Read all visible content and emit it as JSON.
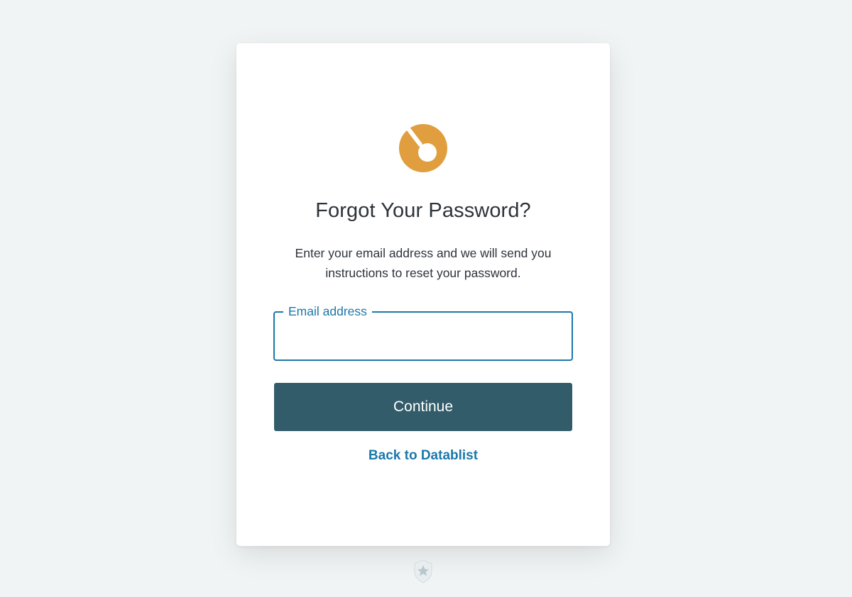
{
  "logo": {
    "icon": "datablist-logo-icon",
    "color": "#e09e3f"
  },
  "heading": "Forgot Your Password?",
  "description": "Enter your email address and we will send you instructions to reset your password.",
  "email_field": {
    "label": "Email address",
    "value": "",
    "border_color": "#1d77a8"
  },
  "continue_button": {
    "label": "Continue",
    "background": "#335c6a"
  },
  "back_link": {
    "label": "Back to Datablist",
    "color": "#1a78ac"
  },
  "footer": {
    "icon": "auth0-shield-icon"
  }
}
